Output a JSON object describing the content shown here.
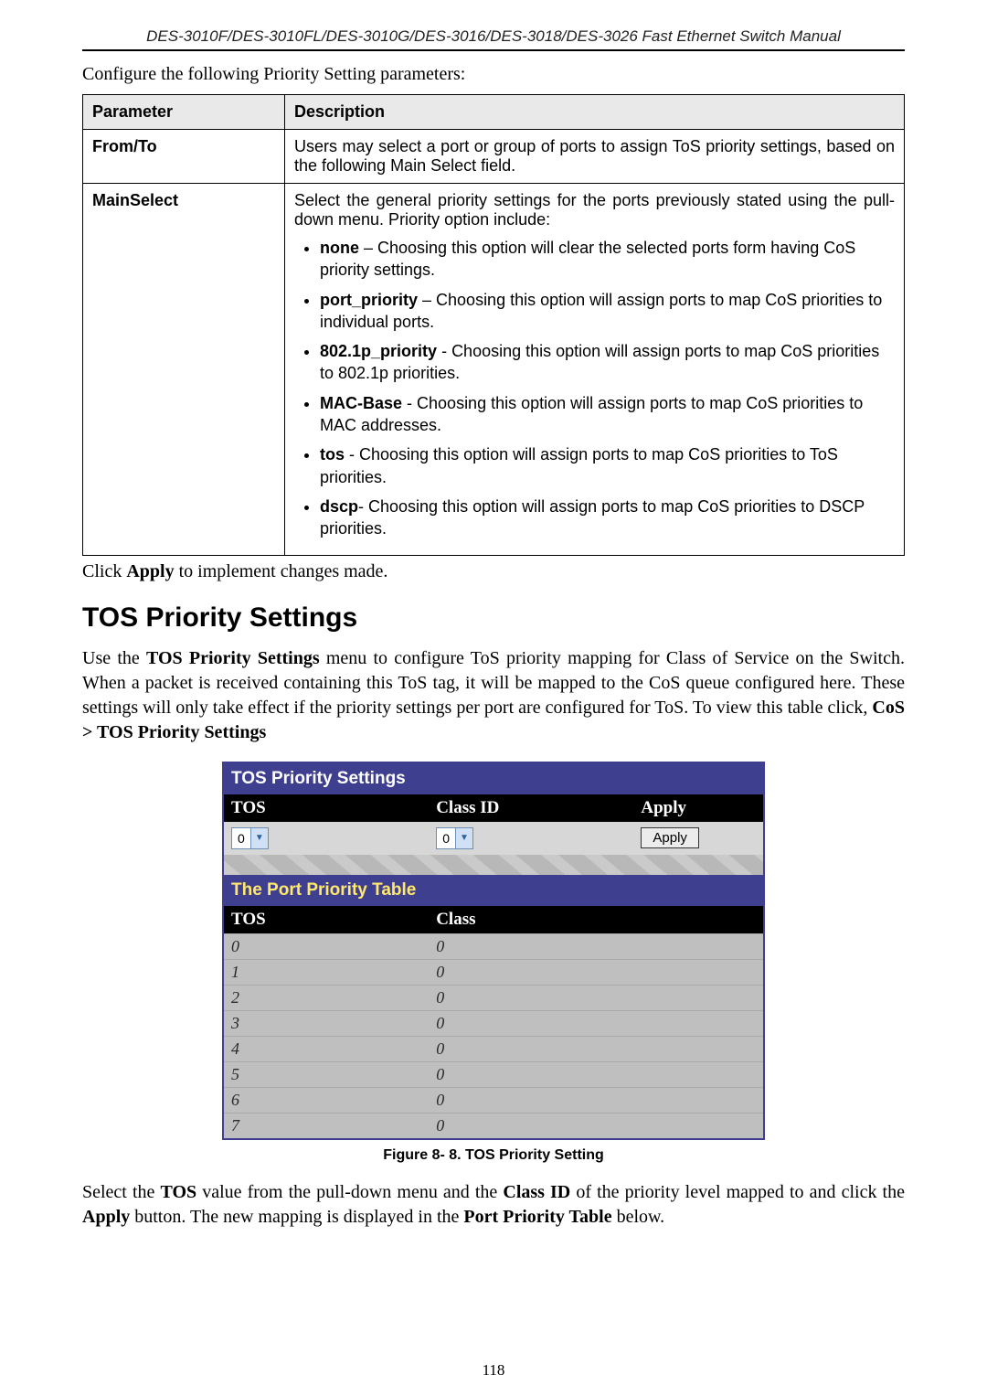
{
  "running_head": "DES-3010F/DES-3010FL/DES-3010G/DES-3016/DES-3018/DES-3026 Fast Ethernet Switch Manual",
  "intro_line": "Configure the following Priority Setting parameters:",
  "param_table": {
    "headers": [
      "Parameter",
      "Description"
    ],
    "rows": [
      {
        "param": "From/To",
        "desc_lead": "Users may select a port or group of ports to assign ToS priority settings, based on the following Main Select field.",
        "options": []
      },
      {
        "param": "MainSelect",
        "desc_lead": "Select the general priority settings for the ports previously stated using the pull-down menu. Priority option include:",
        "options": [
          {
            "label": "none",
            "sep": " – ",
            "text": "Choosing this option will clear the selected ports form having CoS priority settings."
          },
          {
            "label": "port_priority",
            "sep": " – ",
            "text": "Choosing this option will assign ports to map CoS priorities to individual ports."
          },
          {
            "label": "802.1p_priority",
            "sep": " - ",
            "text": "Choosing this option will assign ports to map CoS priorities to 802.1p priorities."
          },
          {
            "label": "MAC-Base",
            "sep": " - ",
            "text": "Choosing this option will assign ports to map CoS priorities to MAC addresses."
          },
          {
            "label": "tos",
            "sep": " - ",
            "text": "Choosing this option will assign ports to map CoS priorities to ToS priorities."
          },
          {
            "label": "dscp",
            "sep": "- ",
            "text": "Choosing this option will assign ports to map CoS priorities to DSCP priorities."
          }
        ]
      }
    ]
  },
  "after_table": {
    "pre": "Click ",
    "bold": "Apply",
    "post": " to implement changes made."
  },
  "section_heading": "TOS Priority Settings",
  "body1": {
    "s1a": "Use the ",
    "s1b": "TOS Priority Settings",
    "s1c": " menu to configure ToS priority mapping for Class of Service on the Switch. When a packet is received containing this ToS tag, it will be mapped to the CoS queue configured here. These settings will only take effect if the priority settings per port are configured for ToS. To view this table click, ",
    "s1d": "CoS > TOS Priority Settings"
  },
  "shot": {
    "panel_title": "TOS Priority Settings",
    "cols": {
      "tos": "TOS",
      "classid": "Class ID",
      "apply": "Apply"
    },
    "tos_value": "0",
    "classid_value": "0",
    "apply_label": "Apply",
    "port_panel_title": "The Port Priority Table",
    "port_cols": {
      "tos": "TOS",
      "class": "Class"
    },
    "port_rows": [
      {
        "tos": "0",
        "class": "0"
      },
      {
        "tos": "1",
        "class": "0"
      },
      {
        "tos": "2",
        "class": "0"
      },
      {
        "tos": "3",
        "class": "0"
      },
      {
        "tos": "4",
        "class": "0"
      },
      {
        "tos": "5",
        "class": "0"
      },
      {
        "tos": "6",
        "class": "0"
      },
      {
        "tos": "7",
        "class": "0"
      }
    ]
  },
  "figure_caption": "Figure 8- 8. TOS Priority Setting",
  "body2": {
    "a": "Select the ",
    "b": "TOS",
    "c": " value from the pull-down menu and the ",
    "d": "Class ID",
    "e": " of the priority level mapped to and click the ",
    "f": "Apply",
    "g": " button. The new mapping is displayed in the ",
    "h": "Port Priority Table",
    "i": " below."
  },
  "page_number": "118"
}
